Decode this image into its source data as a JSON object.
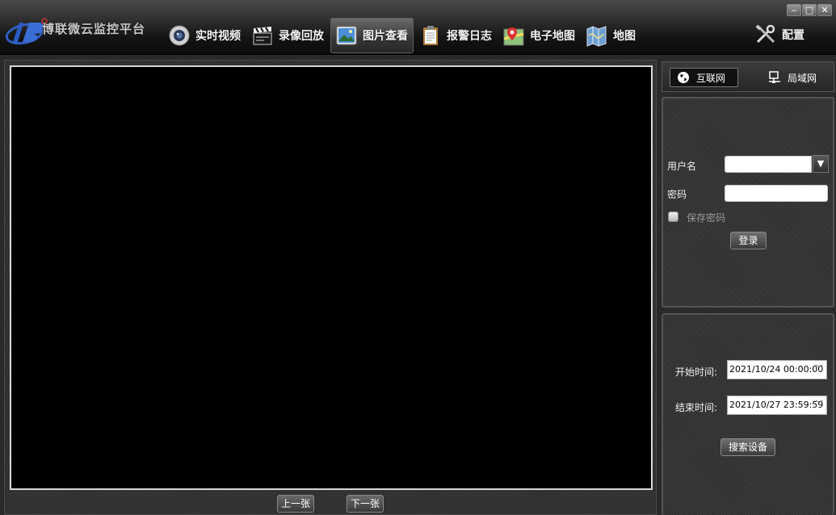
{
  "app": {
    "title": "博联微云监控平台"
  },
  "window_controls": {
    "minimize": "‒",
    "maximize": "□",
    "close": "✕"
  },
  "nav": {
    "items": [
      {
        "label": "实时视频",
        "icon": "camera-icon"
      },
      {
        "label": "录像回放",
        "icon": "clapperboard-icon"
      },
      {
        "label": "图片查看",
        "icon": "picture-icon",
        "active": true
      },
      {
        "label": "报警日志",
        "icon": "clipboard-icon"
      },
      {
        "label": "电子地图",
        "icon": "map-pin-icon"
      },
      {
        "label": "地图",
        "icon": "folded-map-icon"
      }
    ],
    "config_label": "配置"
  },
  "viewer": {
    "prev_label": "上一张",
    "next_label": "下一张"
  },
  "network_tabs": {
    "internet_label": "互联网",
    "lan_label": "局域网",
    "active": "internet"
  },
  "login": {
    "username_label": "用户名",
    "username_value": "",
    "password_label": "密码",
    "password_value": "",
    "remember_label": "保存密码",
    "remember_checked": false,
    "login_button": "登录"
  },
  "search": {
    "start_label": "开始时间:",
    "start_value": "2021/10/24 00:00:00",
    "end_label": "结束时间:",
    "end_value": "2021/10/27 23:59:59",
    "search_button": "搜索设备"
  },
  "colors": {
    "screen_background": "#000000",
    "toolbar_top": "#4a4a4a",
    "panel_background": "#353535"
  }
}
